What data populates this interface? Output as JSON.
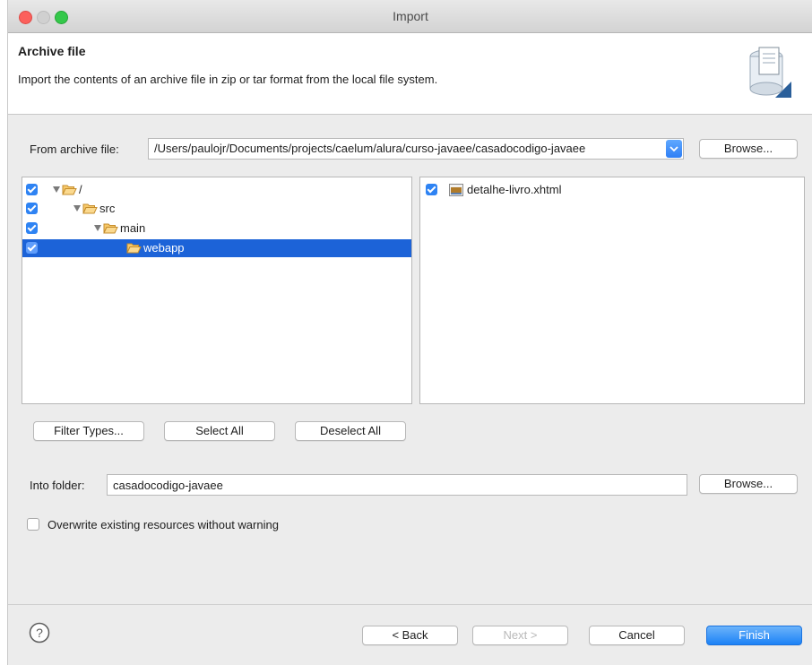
{
  "window": {
    "title": "Import"
  },
  "header": {
    "title": "Archive file",
    "description": "Import the contents of an archive file in zip or tar format from the local file system."
  },
  "archive": {
    "label": "From archive file:",
    "value": "/Users/paulojr/Documents/projects/caelum/alura/curso-javaee/casadocodigo-javaee",
    "browse_label": "Browse..."
  },
  "tree": {
    "items": [
      {
        "label": "/",
        "checked": true,
        "expanded": true,
        "depth": 0
      },
      {
        "label": "src",
        "checked": true,
        "expanded": true,
        "depth": 1
      },
      {
        "label": "main",
        "checked": true,
        "expanded": true,
        "depth": 2
      },
      {
        "label": "webapp",
        "checked": true,
        "expanded": false,
        "depth": 3,
        "selected": true
      }
    ]
  },
  "files": {
    "items": [
      {
        "label": "detalhe-livro.xhtml",
        "checked": true
      }
    ]
  },
  "buttons": {
    "filter_types": "Filter Types...",
    "select_all": "Select All",
    "deselect_all": "Deselect All"
  },
  "into_folder": {
    "label": "Into folder:",
    "value": "casadocodigo-javaee",
    "browse_label": "Browse..."
  },
  "overwrite": {
    "label": "Overwrite existing resources without warning",
    "checked": false
  },
  "footer": {
    "back": "< Back",
    "next": "Next >",
    "cancel": "Cancel",
    "finish": "Finish"
  },
  "colors": {
    "accent": "#2e83f3",
    "selection": "#1c63d8",
    "close": "#fc605c",
    "zoom": "#34c84a"
  }
}
